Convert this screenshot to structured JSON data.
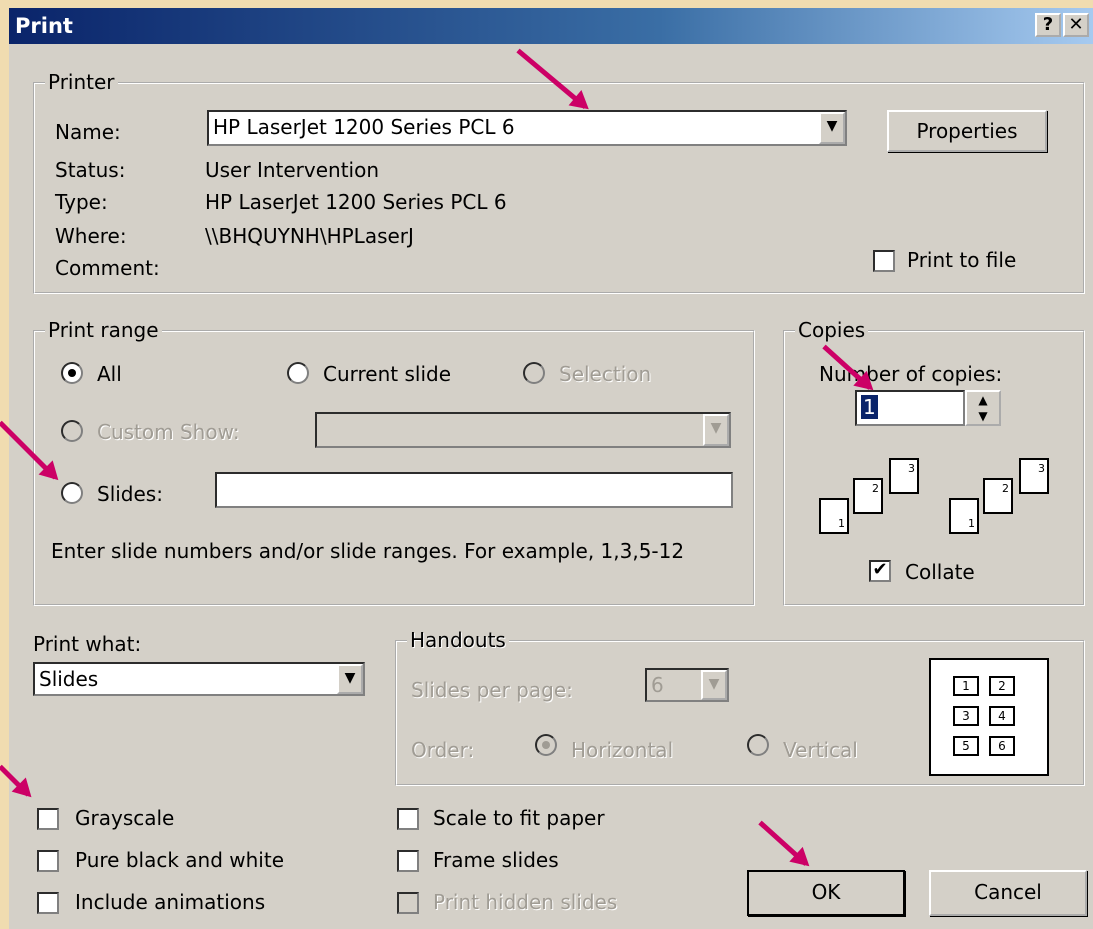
{
  "title": "Print",
  "title_buttons": {
    "help": "?",
    "close": "✕"
  },
  "printer": {
    "legend": "Printer",
    "name_label": "Name:",
    "name_value": "HP LaserJet 1200 Series PCL 6",
    "properties": "Properties",
    "status_label": "Status:",
    "status_value": "User Intervention",
    "type_label": "Type:",
    "type_value": "HP LaserJet 1200 Series PCL 6",
    "where_label": "Where:",
    "where_value": "\\\\BHQUYNH\\HPLaserJ",
    "comment_label": "Comment:",
    "print_to_file": "Print to file"
  },
  "range": {
    "legend": "Print range",
    "all": "All",
    "current_slide": "Current slide",
    "selection": "Selection",
    "custom_show": "Custom Show:",
    "slides": "Slides:",
    "hint": "Enter slide numbers and/or slide ranges. For example, 1,3,5-12"
  },
  "copies": {
    "legend": "Copies",
    "number_label": "Number of copies:",
    "number_value": "1",
    "collate": "Collate",
    "pages": [
      "1",
      "2",
      "3"
    ]
  },
  "print_what": {
    "label": "Print what:",
    "value": "Slides"
  },
  "handouts": {
    "legend": "Handouts",
    "spp_label": "Slides per page:",
    "spp_value": "6",
    "order_label": "Order:",
    "horizontal": "Horizontal",
    "vertical": "Vertical",
    "grid": [
      "1",
      "2",
      "3",
      "4",
      "5",
      "6"
    ]
  },
  "options": {
    "grayscale": "Grayscale",
    "pure_bw": "Pure black and white",
    "include_animations": "Include animations",
    "scale_to_fit": "Scale to fit paper",
    "frame_slides": "Frame slides",
    "print_hidden": "Print hidden slides"
  },
  "buttons": {
    "ok": "OK",
    "cancel": "Cancel"
  },
  "colors": {
    "annotation_arrow": "#cc0066",
    "title_bar": "#0a246a",
    "dialog_face": "#d4d0c8"
  }
}
